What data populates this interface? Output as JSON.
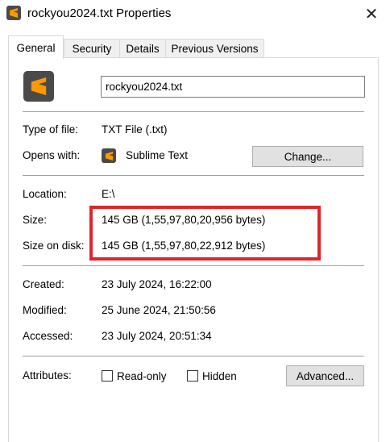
{
  "window": {
    "title": "rockyou2024.txt Properties",
    "close_glyph": "✕"
  },
  "tabs": [
    {
      "label": "General",
      "active": true
    },
    {
      "label": "Security",
      "active": false
    },
    {
      "label": "Details",
      "active": false
    },
    {
      "label": "Previous Versions",
      "active": false
    }
  ],
  "file": {
    "name": "rockyou2024.txt",
    "icon": "sublime-text-icon",
    "icon_color": "#ff9800"
  },
  "type": {
    "label": "Type of file:",
    "value": "TXT File (.txt)"
  },
  "opens_with": {
    "label": "Opens with:",
    "value": "Sublime Text",
    "button": "Change..."
  },
  "location": {
    "label": "Location:",
    "value": "E:\\"
  },
  "size": {
    "label": "Size:",
    "value": "145 GB (1,55,97,80,20,956 bytes)"
  },
  "size_on_disk": {
    "label": "Size on disk:",
    "value": "145 GB (1,55,97,80,22,912 bytes)"
  },
  "highlight_color": "#e0262b",
  "dates": {
    "created_label": "Created:",
    "created": "23 July 2024, 16:22:00",
    "modified_label": "Modified:",
    "modified": "25 June 2024, 21:50:56",
    "accessed_label": "Accessed:",
    "accessed": "23 July 2024, 20:51:34"
  },
  "attributes": {
    "label": "Attributes:",
    "readonly": "Read-only",
    "readonly_checked": false,
    "hidden": "Hidden",
    "hidden_checked": false,
    "advanced_button": "Advanced..."
  }
}
